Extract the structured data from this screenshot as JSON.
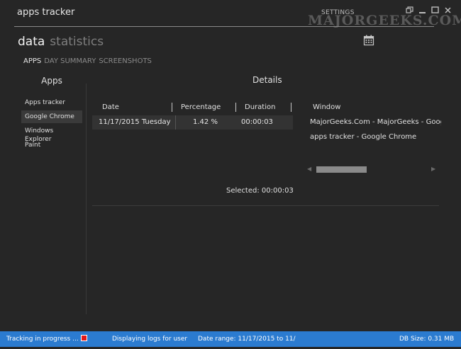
{
  "app": {
    "title": "apps tracker",
    "settings_label": "SETTINGS",
    "watermark": "MAJORGEEKS.COM"
  },
  "window_buttons": [
    "restore-icon",
    "minimize-icon",
    "maximize-icon",
    "close-icon"
  ],
  "main_tabs": {
    "data": "data",
    "statistics": "statistics"
  },
  "sub_tabs": {
    "apps": "APPS",
    "day_summary": "DAY SUMMARY",
    "screenshots": "SCREENSHOTS"
  },
  "apps_panel": {
    "header": "Apps",
    "items": [
      "Apps tracker",
      "Google Chrome",
      "Windows Explorer",
      "Paint"
    ],
    "selected_index": 1
  },
  "details": {
    "header": "Details",
    "columns": [
      "Date",
      "Percentage",
      "Duration"
    ],
    "rows": [
      {
        "date": "11/17/2015 Tuesday",
        "percentage": "1.42 %",
        "duration": "00:00:03"
      }
    ],
    "window_header": "Window",
    "windows": [
      "MajorGeeks.Com - MajorGeeks - Goog",
      "apps tracker - Google Chrome"
    ],
    "selected_text": "Selected: 00:00:03"
  },
  "status": {
    "tracking": "Tracking in progress ...",
    "displaying": "Displaying logs for user",
    "date_range": "Date range: 11/17/2015 to 11/",
    "db_size": "DB Size: 0.31 MB"
  },
  "colors": {
    "background": "#262626",
    "status_bar": "#2b7bd0",
    "stop_button": "#e01919"
  }
}
